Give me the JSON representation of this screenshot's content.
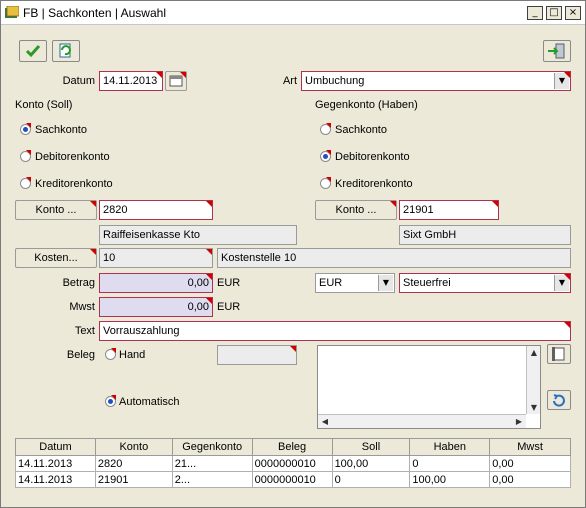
{
  "window": {
    "title": "FB | Sachkonten | Auswahl",
    "min": "_",
    "max": "□",
    "close": "×"
  },
  "header": {
    "datum_label": "Datum",
    "datum_value": "14.11.2013",
    "art_label": "Art",
    "art_value": "Umbuchung"
  },
  "soll": {
    "heading": "Konto (Soll)",
    "options": [
      "Sachkonto",
      "Debitorenkonto",
      "Kreditorenkonto"
    ],
    "selected": "Sachkonto",
    "konto_button": "Konto ...",
    "konto_value": "2820",
    "konto_name": "Raiffeisenkasse Kto"
  },
  "haben": {
    "heading": "Gegenkonto (Haben)",
    "options": [
      "Sachkonto",
      "Debitorenkonto",
      "Kreditorenkonto"
    ],
    "selected": "Debitorenkonto",
    "konto_button": "Konto ...",
    "konto_value": "21901",
    "konto_name": "Sixt GmbH"
  },
  "kosten": {
    "button": "Kosten...",
    "value": "10",
    "name": "Kostenstelle 10"
  },
  "betrag": {
    "label": "Betrag",
    "value": "0,00",
    "unit": "EUR",
    "currency": "EUR",
    "tax": "Steuerfrei"
  },
  "mwst": {
    "label": "Mwst",
    "value": "0,00",
    "unit": "EUR"
  },
  "text": {
    "label": "Text",
    "value": "Vorrauszahlung"
  },
  "beleg": {
    "label": "Beleg",
    "hand": "Hand",
    "auto": "Automatisch",
    "selected": "Automatisch"
  },
  "table": {
    "columns": [
      "Datum",
      "Konto",
      "Gegenkonto",
      "Beleg",
      "Soll",
      "Haben",
      "Mwst"
    ],
    "rows": [
      [
        "14.11.2013",
        "2820",
        "21...",
        "0000000010",
        "100,00",
        "0",
        "0,00"
      ],
      [
        "14.11.2013",
        "21901",
        "2...",
        "0000000010",
        "0",
        "100,00",
        "0,00"
      ]
    ]
  },
  "colors": {
    "accent_border": "#b03050",
    "required_mark": "#d00000",
    "numeric_bg": "#e0dcf0"
  },
  "icons": {
    "save": "checkmark-icon",
    "refresh": "refresh-icon",
    "exit": "exit-icon",
    "calendar": "calendar-icon",
    "document": "document-icon",
    "undo": "undo-icon"
  }
}
